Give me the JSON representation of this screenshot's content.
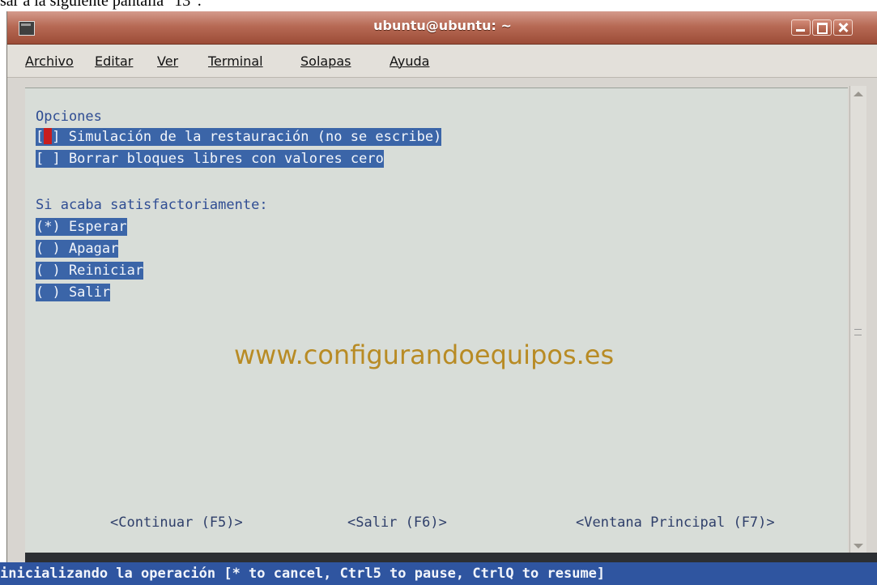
{
  "page_caption": "sar a la siguiente pantalla \"13\":",
  "window": {
    "title": "ubuntu@ubuntu: ~",
    "controls": {
      "minimize": "minimize-icon",
      "maximize": "maximize-icon",
      "close": "close-icon"
    }
  },
  "menubar": {
    "items": [
      "Archivo",
      "Editar",
      "Ver",
      "Terminal",
      "Solapas",
      "Ayuda"
    ]
  },
  "terminal": {
    "options_heading": "Opciones",
    "options": [
      {
        "prefix": "[",
        "suffix": "] Simulación de la restauración (no se escribe)",
        "checked": true
      },
      {
        "text": "[ ] Borrar bloques libres con valores cero",
        "checked": false
      }
    ],
    "success_heading": "Si acaba satisfactoriamente:",
    "radio_options": [
      {
        "text": "(*) Esperar",
        "selected": true
      },
      {
        "text": "( ) Apagar",
        "selected": false
      },
      {
        "text": "( ) Reiniciar",
        "selected": false
      },
      {
        "text": "( ) Salir",
        "selected": false
      }
    ],
    "watermark": "www.configurandoequipos.es",
    "buttons": {
      "continue": "<Continuar (F5)>",
      "exit": "<Salir (F6)>",
      "main_window": "<Ventana Principal (F7)>"
    }
  },
  "status_line": "inicializando la operación [* to cancel, Ctrl5 to pause, CtrlQ to resume]",
  "colors": {
    "titlebar": "#b76a55",
    "highlight": "#3b65a8",
    "terminal_bg": "#d8ddd8",
    "terminal_text": "#2f4d93",
    "watermark": "#b88b24",
    "cursor": "#c81e1e",
    "status_bg": "#2f55a0"
  }
}
